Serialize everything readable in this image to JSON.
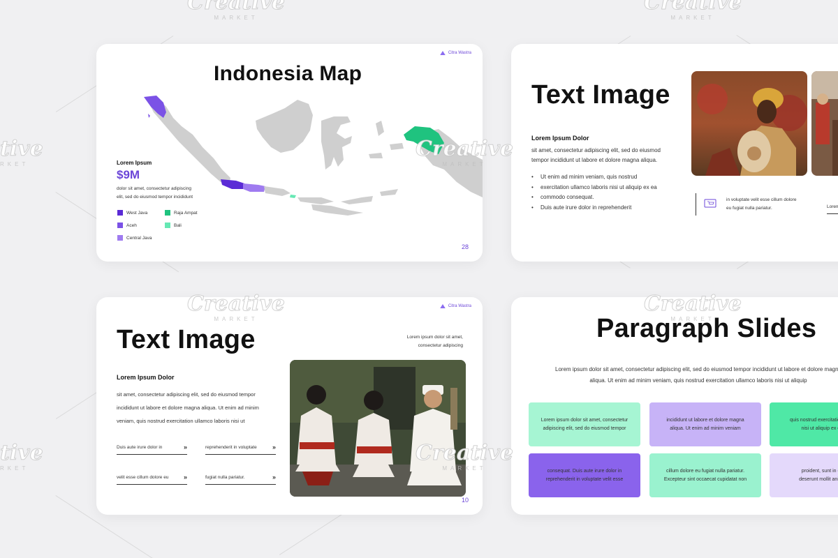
{
  "brand": "Citra Wastra",
  "watermark": {
    "word": "Creative",
    "sub": "MARKET",
    "cut_left": "tive",
    "cut_left_sub": "RKET",
    "cut_top": "Creative",
    "cut_top_sub": "MARKET"
  },
  "slide1": {
    "title": "Indonesia Map",
    "stat_label": "Lorem Ipsum",
    "stat_value": "$9M",
    "desc1": "dolor sit amet, consectetur adipiscing",
    "desc2": "elit, sed do eiusmod tempor incididunt",
    "legend": [
      {
        "label": "West Java",
        "color": "#5b2bd6"
      },
      {
        "label": "Raja Ampat",
        "color": "#1fc37f"
      },
      {
        "label": "Aceh",
        "color": "#7b52e6"
      },
      {
        "label": "Bali",
        "color": "#66e8b4"
      },
      {
        "label": "Central Java",
        "color": "#9f7bf0"
      }
    ],
    "page": "28"
  },
  "slide2": {
    "title": "Text Image",
    "subtitle": "Lorem Ipsum Dolor",
    "para1": "sit amet, consectetur adipiscing elit, sed do eiusmod",
    "para2": "tempor incididunt ut labore et dolore magna aliqua.",
    "bullets": [
      "Ut enim ad minim veniam, quis nostrud",
      "exercitation ullamco laboris nisi ut aliquip ex ea",
      "commodo consequat.",
      "Duis aute irure dolor in reprehenderit"
    ],
    "note1": "in voluptate velit esse cillum dolore",
    "note2": "eu fugiat nulla pariatur.",
    "cut_text": "Lorem"
  },
  "slide3": {
    "title": "Text Image",
    "top_right1": "Lorem ipsum dolor sit amet,",
    "top_right2": "consectetur adipiscing",
    "subtitle": "Lorem Ipsum Dolor",
    "para1": "sit amet, consectetur adipiscing elit, sed do eiusmod tempor",
    "para2": "incididunt ut labore et dolore magna aliqua. Ut enim ad minim",
    "para3": "veniam, quis nostrud exercitation ullamco laboris nisi ut",
    "links": [
      "Duis aute irure dolor in",
      "reprehenderit in voluptate",
      "velit esse cillum dolore eu",
      "fugiat nulla pariatur."
    ],
    "arrow": "»",
    "page": "10"
  },
  "slide4": {
    "title": "Paragraph Slides",
    "intro1": "Lorem ipsum dolor sit amet, consectetur adipiscing elit, sed do eiusmod tempor incididunt ut labore et dolore magna",
    "intro2": "aliqua. Ut enim ad minim veniam, quis nostrud exercitation ullamco laboris nisi ut aliquip",
    "cards": [
      {
        "l1": "Lorem ipsum dolor sit amet, consectetur",
        "l2": "adipiscing elit, sed do eiusmod tempor",
        "color": "#a6f5d3"
      },
      {
        "l1": "incididunt ut labore et dolore magna",
        "l2": "aliqua. Ut enim ad minim veniam",
        "color": "#c7b3f7"
      },
      {
        "l1": "quis nostrud exercitation ullamco",
        "l2": "nisi ut aliquip ex ea co",
        "color": "#4fe8a6"
      },
      {
        "l1": "consequat. Duis aute irure dolor in",
        "l2": "reprehenderit in voluptate velit esse",
        "color": "#8a63ec"
      },
      {
        "l1": "cillum dolore eu fugiat nulla pariatur.",
        "l2": "Excepteur sint occaecat cupidatat non",
        "color": "#9af2cf"
      },
      {
        "l1": "proident, sunt in culpa",
        "l2": "deserunt mollit anim id e",
        "color": "#e4d9fb"
      }
    ]
  }
}
